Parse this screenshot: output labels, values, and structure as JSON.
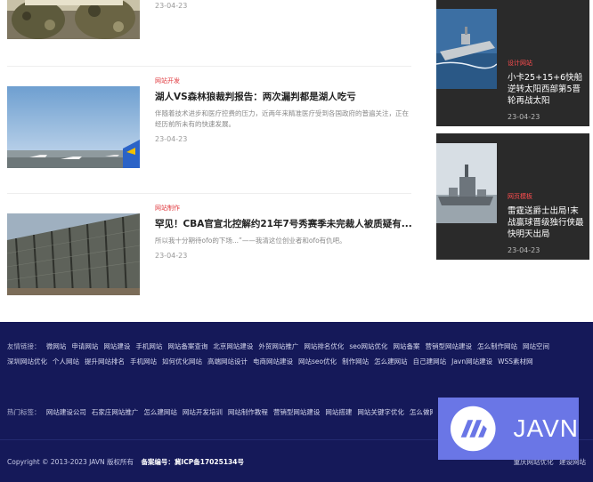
{
  "articles": [
    {
      "category": "",
      "title": "",
      "desc": "",
      "date": "23-04-23"
    },
    {
      "category": "网站开发",
      "title": "湖人VS森林狼裁判报告：两次漏判都是湖人吃亏",
      "desc": "伴随着技术进步和医疗控费的压力，近两年来精准医疗受到各国政府的普遍关注，正在经历前所未有的快速发展。",
      "date": "23-04-23"
    },
    {
      "category": "网站制作",
      "title": "罕见！CBA官宣北控解约21年7号秀赛季未完裁人被质疑有...",
      "desc": "所以我十分期待ofo的下场...”——我清这位创业者和ofo有仇吧。",
      "date": "23-04-23"
    }
  ],
  "side_cards": [
    {
      "category": "设计网站",
      "title": "小卡25+15+6快船逆转太阳西部第5晋轮再战太阳",
      "date": "23-04-23"
    },
    {
      "category": "网页模板",
      "title": "雷霆送爵士出局!末战赢球晋级独行侠最快明天出局",
      "date": "23-04-23"
    }
  ],
  "footer": {
    "friend_label": "友情链接：",
    "friend_links_row1": [
      "微网站",
      "申请网站",
      "网站建设",
      "手机网站",
      "网站备案查询",
      "北京网站建设",
      "外贸网站推广",
      "网站排名优化",
      "seo网站优化",
      "网站备案",
      "营销型网站建设",
      "怎么制作网站",
      "网站空间"
    ],
    "friend_links_row2": [
      "深圳网站优化",
      "个人网站",
      "提升网站排名",
      "手机网站",
      "如何优化网站",
      "高端网站设计",
      "电商网站建设",
      "网站seo优化",
      "制作网站",
      "怎么建网站",
      "自己建网站",
      "Javn网站建设",
      "WSS素材网"
    ],
    "hot_label": "热门标签：",
    "hot_tags": [
      "网站建设公司",
      "石家庄网站推广",
      "怎么建网站",
      "网站开发培训",
      "网站制作教程",
      "营销型网站建设",
      "网站搭建",
      "网站关键字优化",
      "怎么做网站"
    ],
    "copyright": "Copyright © 2013-2023 JAVN 版权所有",
    "icp_label": "备案编号：",
    "icp_value": "冀ICP备17025134号",
    "right_links": [
      "重庆网站优化",
      "建设网站"
    ],
    "brand": "JAVN"
  },
  "colors": {
    "footer_bg": "#151959",
    "accent_red": "#e0393e",
    "badge_bg": "#6a76e6"
  }
}
